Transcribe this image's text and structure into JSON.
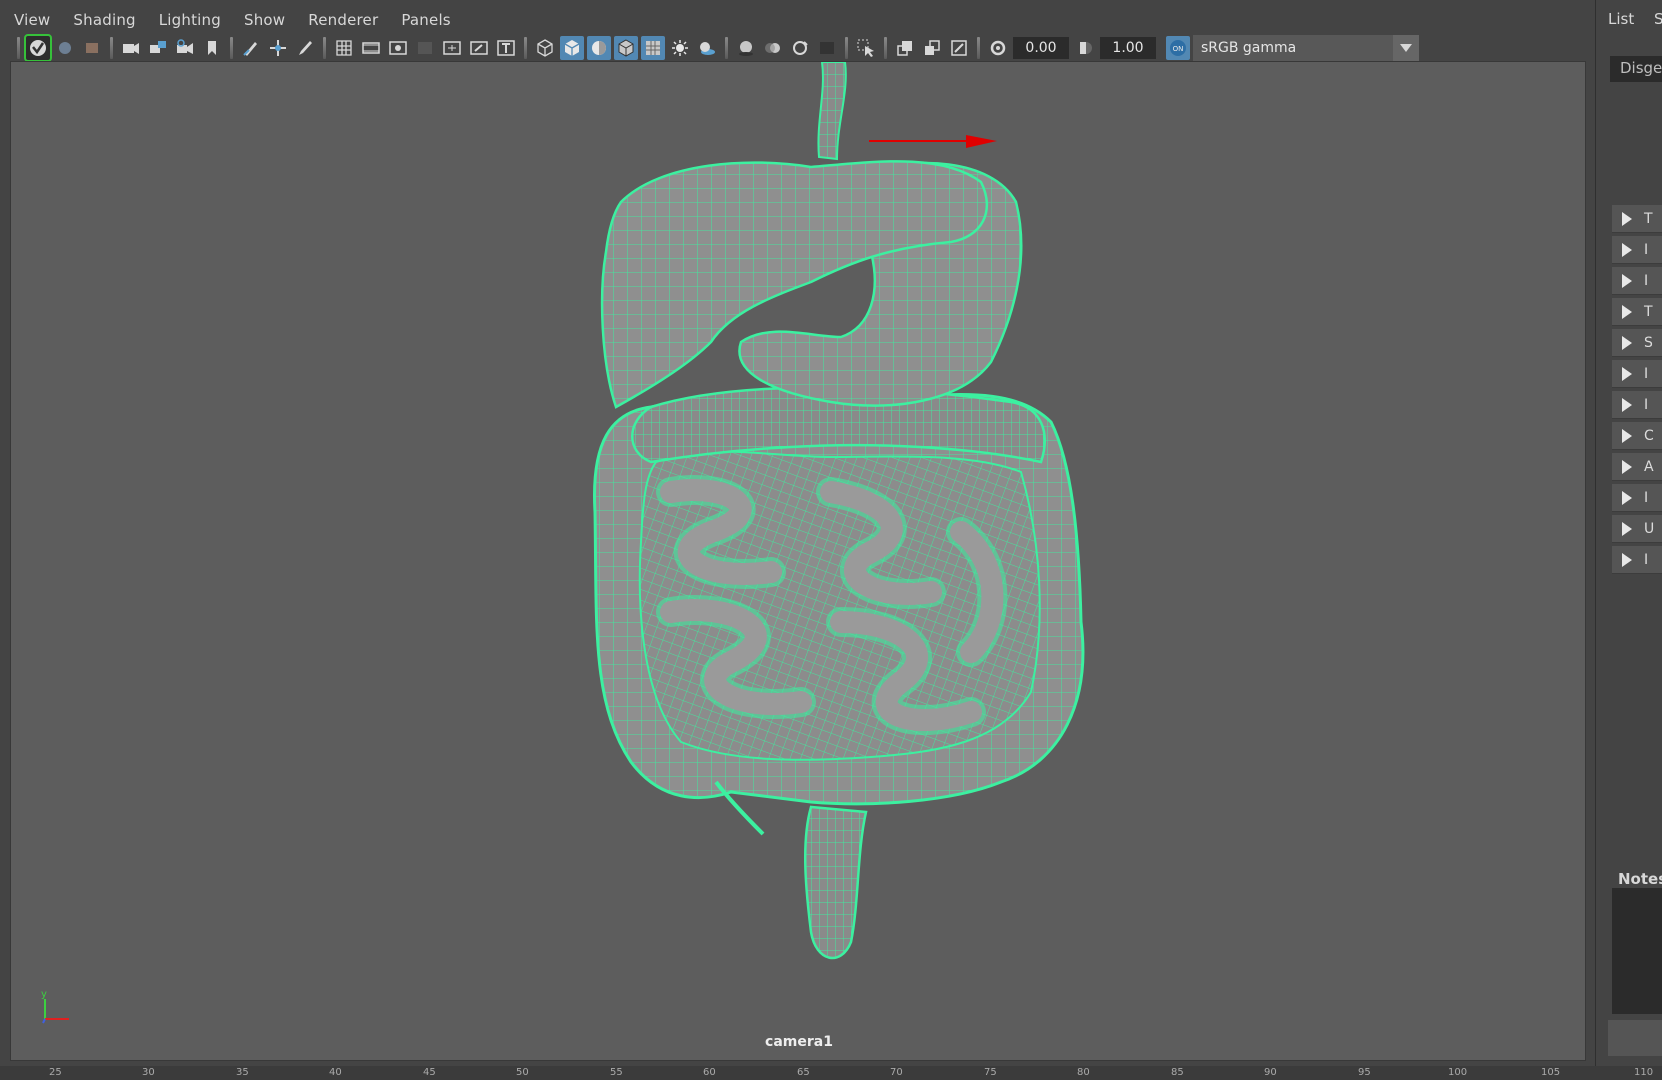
{
  "menubar": {
    "items": [
      "View",
      "Shading",
      "Lighting",
      "Show",
      "Renderer",
      "Panels"
    ]
  },
  "toolbar": {
    "exposure_value": "0.00",
    "gamma_value": "1.00",
    "color_management_label": "sRGB gamma",
    "icons": [
      "select-camera-icon",
      "lock-camera-icon",
      "bookmark-icon",
      "camera-attributes-icon",
      "image-plane-icon",
      "2d-pan-zoom-icon",
      "grease-pencil-icon",
      "grid-icon",
      "film-gate-icon",
      "resolution-gate-icon",
      "gate-mask-icon",
      "field-chart-icon",
      "safe-action-icon",
      "safe-title-icon",
      "wireframe-icon",
      "smooth-shade-icon",
      "default-material-icon",
      "wireframe-on-shaded-icon",
      "xray-icon",
      "use-all-lights-icon",
      "shadows-icon",
      "screen-space-ao-icon",
      "motion-blur-icon",
      "multisample-aa-icon",
      "depth-of-field-icon",
      "isolate-select-icon",
      "xray-joints-icon",
      "xray-active-icon",
      "exposure-icon",
      "gamma-icon",
      "color-management-icon"
    ]
  },
  "viewport": {
    "camera_label": "camera1",
    "axis_y_label": "y",
    "wire_color": "#3cf0a0",
    "shade_color": "#8f8f8f",
    "background_color": "#5d5d5d"
  },
  "timeline": {
    "ticks": [
      "25",
      "30",
      "35",
      "40",
      "45",
      "50",
      "55",
      "60",
      "65",
      "70",
      "75",
      "80",
      "85",
      "90",
      "95",
      "100",
      "105",
      "110"
    ]
  },
  "right_panel": {
    "tab_list": "List",
    "tab_s": "S",
    "name_field": "Disge",
    "section_rows": [
      "T",
      "I",
      "I",
      "T",
      "S",
      "I",
      "I",
      "C",
      "A",
      "I",
      "U",
      "I"
    ],
    "notes_label": "Notes:"
  }
}
